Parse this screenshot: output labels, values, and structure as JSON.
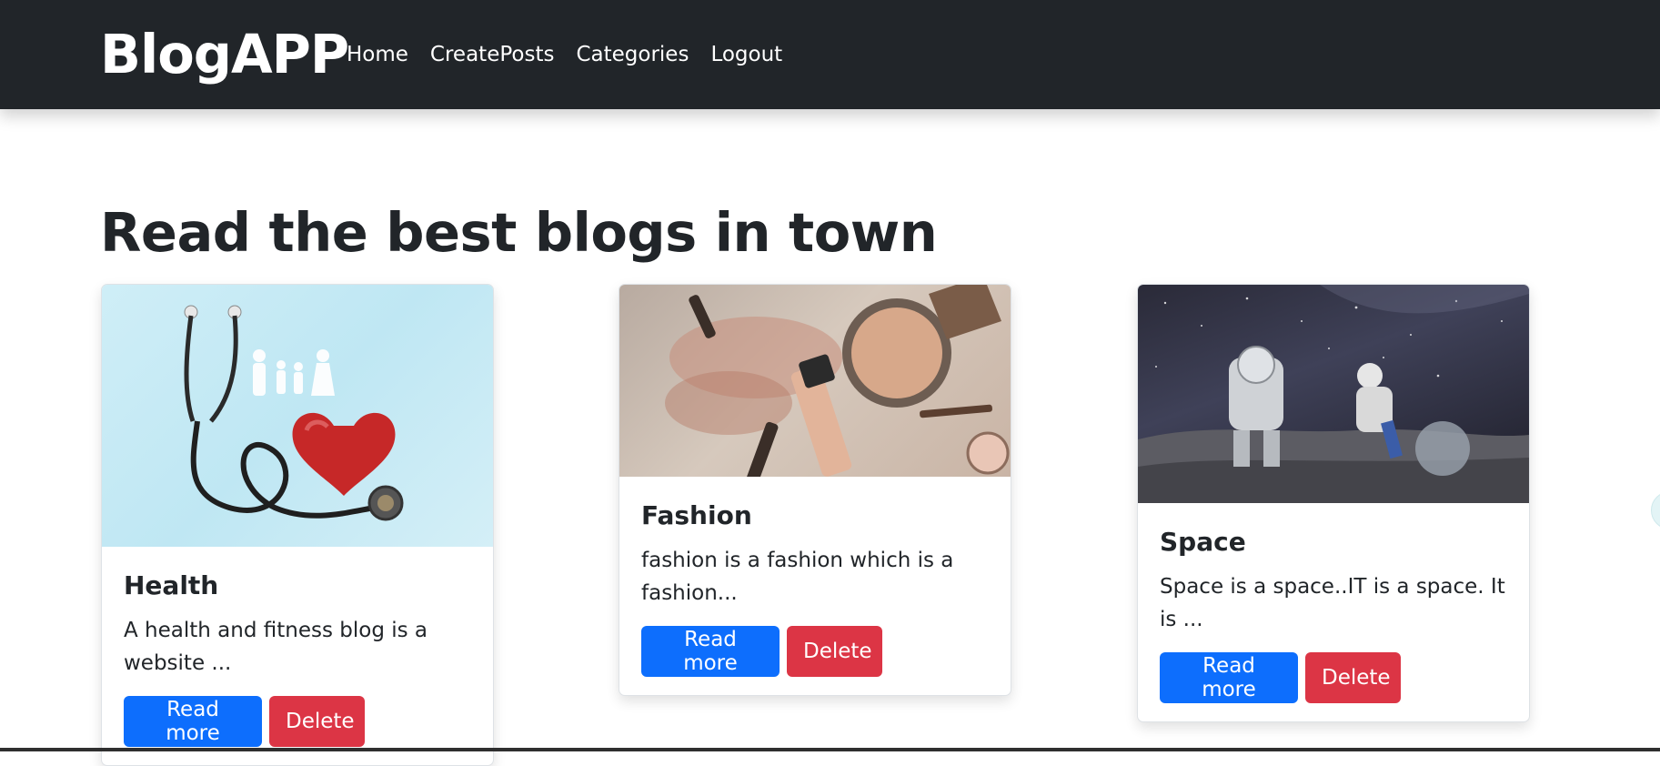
{
  "navbar": {
    "brand": "BlogAPP",
    "links": [
      {
        "label": "Home"
      },
      {
        "label": "CreatePosts"
      },
      {
        "label": "Categories"
      },
      {
        "label": "Logout"
      }
    ]
  },
  "page": {
    "headline": "Read the best blogs in town"
  },
  "cards": [
    {
      "title": "Health",
      "text": "A health and fitness blog is a website ...",
      "read_more": "Read more",
      "delete": "Delete",
      "image": "stethoscope-heart-family-image"
    },
    {
      "title": "Fashion",
      "text": "fashion is a fashion which is a fashion...",
      "read_more": "Read more",
      "delete": "Delete",
      "image": "makeup-products-image"
    },
    {
      "title": "Space",
      "text": "Space is a space..IT is a space. It is ...",
      "read_more": "Read more",
      "delete": "Delete",
      "image": "astronauts-moon-image"
    }
  ],
  "colors": {
    "navbar_bg": "#212529",
    "primary": "#0d6efd",
    "danger": "#dc3545"
  }
}
